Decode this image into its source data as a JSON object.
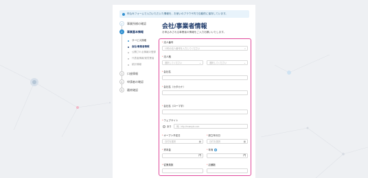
{
  "notice": "申込みフォームで入力いただいた情報を、お使いのブラウザ内で自動的に保存しています。",
  "steps": [
    {
      "num": "✓",
      "label": "事業所様の確認"
    },
    {
      "num": "2",
      "label": "事業基本情報"
    },
    {
      "num": "3",
      "label": "口座情報"
    },
    {
      "num": "4",
      "label": "申請者の確認"
    },
    {
      "num": "5",
      "label": "最終確認"
    }
  ],
  "substeps": [
    {
      "label": "サービス詳細"
    },
    {
      "label": "会社/事業者情報"
    },
    {
      "label": "公開される情報の登録"
    },
    {
      "label": "代表者情報/実質業者"
    },
    {
      "label": "統計情報"
    }
  ],
  "page": {
    "title": "会社/事業者情報",
    "subtitle": "お申込みされる事業者の情報をご入力お願いいたします。"
  },
  "form": {
    "corp_number_label": "法人番号",
    "corp_number_placeholder": "13桁の法人番号を入力してください",
    "corp_type_label": "法人格",
    "corp_type_placeholder_1": "選択してください",
    "corp_type_placeholder_2": "選択してください",
    "company_name_label": "会社名",
    "company_kana_label": "会社名（カタカナ）",
    "company_roman_label": "会社名（ローマ字）",
    "website_label": "ウェブサイト",
    "website_option": "あり",
    "website_placeholder": "例）http://example.com",
    "open_date_label": "オープン予定日",
    "open_date_placeholder": "日付を選択",
    "established_label": "設立年月日",
    "established_placeholder": "日付を選択",
    "capital_label": "資本金",
    "capital_unit": "円",
    "annual_sales_label": "年商",
    "annual_sales_unit": "円",
    "employees_label": "従業員数",
    "stores_label": "店舗数"
  },
  "colors": {
    "accent": "#2f8fd0",
    "highlight": "#e0479a",
    "title": "#1f3b6b"
  }
}
